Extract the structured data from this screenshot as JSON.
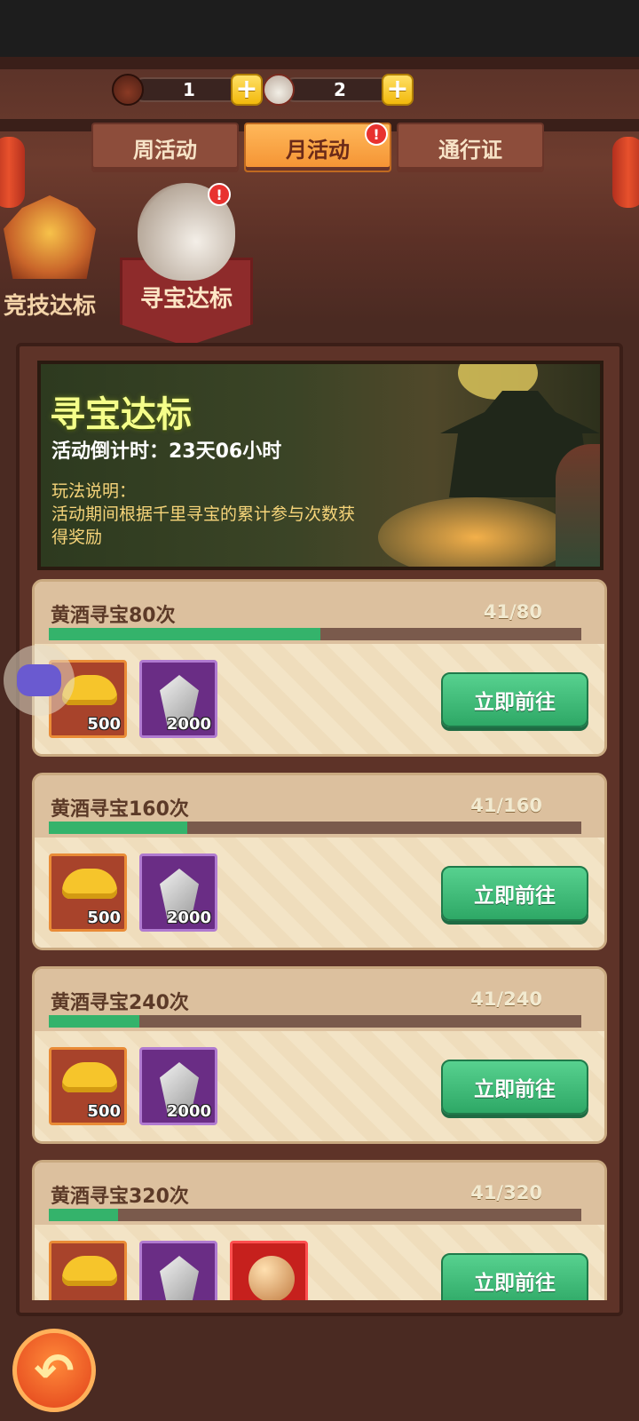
{
  "currency": [
    {
      "name": "yellow-wine-jar",
      "value": "1"
    },
    {
      "name": "treasure-jar",
      "value": "2"
    }
  ],
  "tabs": [
    {
      "label": "周活动",
      "active": false
    },
    {
      "label": "月活动",
      "active": true,
      "badge": "!"
    },
    {
      "label": "通行证",
      "active": false
    }
  ],
  "categories": [
    {
      "label": "竞技达标",
      "active": false
    },
    {
      "label": "寻宝达标",
      "active": true,
      "badge": "!"
    }
  ],
  "banner": {
    "title": "寻宝达标",
    "countdown": "活动倒计时：23天06小时",
    "rules": "玩法说明：\n活动期间根据千里寻宝的累计参与次数获得奖励"
  },
  "tasks": [
    {
      "title": "黄酒寻宝80次",
      "progress_text": "41/80",
      "progress": 0.51,
      "rewards": [
        {
          "type": "gold-ingot",
          "qty": "500"
        },
        {
          "type": "crystal",
          "qty": "2000"
        }
      ],
      "button": "立即前往"
    },
    {
      "title": "黄酒寻宝160次",
      "progress_text": "41/160",
      "progress": 0.26,
      "rewards": [
        {
          "type": "gold-ingot",
          "qty": "500"
        },
        {
          "type": "crystal",
          "qty": "2000"
        }
      ],
      "button": "立即前往"
    },
    {
      "title": "黄酒寻宝240次",
      "progress_text": "41/240",
      "progress": 0.17,
      "rewards": [
        {
          "type": "gold-ingot",
          "qty": "500"
        },
        {
          "type": "crystal",
          "qty": "2000"
        }
      ],
      "button": "立即前往"
    },
    {
      "title": "黄酒寻宝320次",
      "progress_text": "41/320",
      "progress": 0.13,
      "rewards": [
        {
          "type": "gold-ingot",
          "qty": ""
        },
        {
          "type": "crystal",
          "qty": ""
        },
        {
          "type": "orb",
          "qty": ""
        }
      ],
      "button": "立即前往"
    }
  ],
  "colors": {
    "accent": "#34b36b",
    "tab_active": "#f49232",
    "badge": "#e8322f"
  },
  "icons": {
    "back": "back-arrow-icon",
    "plus": "plus-icon",
    "float": "gamepad-icon"
  }
}
